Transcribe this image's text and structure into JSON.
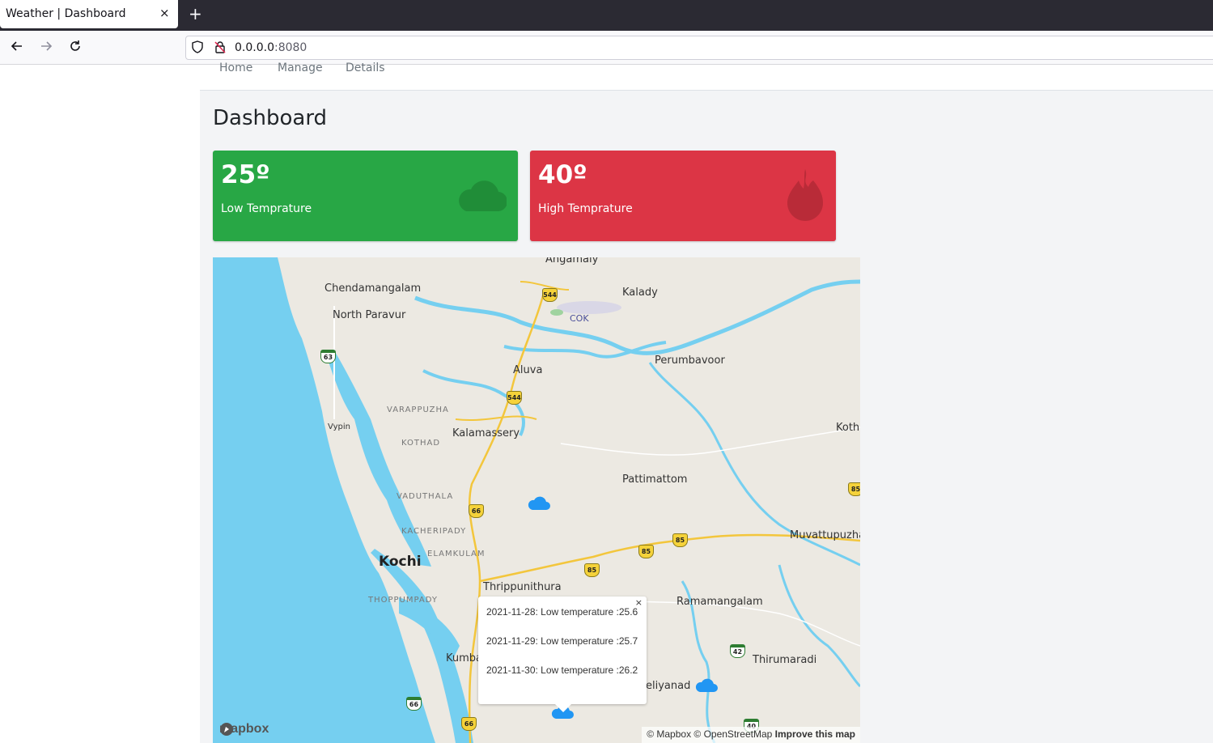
{
  "browser": {
    "tab_title": "Weather | Dashboard",
    "tab_close": "×",
    "new_tab": "+",
    "url_host": "0.0.0.0",
    "url_port": ":8080"
  },
  "nav": {
    "links": [
      "Home",
      "Manage",
      "Details"
    ]
  },
  "page": {
    "title": "Dashboard"
  },
  "cards": [
    {
      "value": "25º",
      "label": "Low Temprature",
      "color": "#28a745",
      "icon": "cloud-icon"
    },
    {
      "value": "40º",
      "label": "High Temprature",
      "color": "#dc3545",
      "icon": "fire-icon"
    }
  ],
  "map": {
    "places": [
      "Angamaly",
      "Chendamangalam",
      "Kalady",
      "North Paravur",
      "COK",
      "Perumbavoor",
      "Aluva",
      "VARAPPUZHA",
      "Vypin",
      "Kalamassery",
      "KOTHAD",
      "Koth",
      "Pattimattom",
      "VADUTHALA",
      "KACHERIPADY",
      "Muvattupuzha",
      "Kochi",
      "ELAMKULAM",
      "Thrippunithura",
      "THOPPUMPADY",
      "Ramamangalam",
      "Kumba",
      "Thirumaradi",
      "eliyanad"
    ],
    "shields": [
      "544",
      "544",
      "63",
      "66",
      "85",
      "85",
      "85",
      "85",
      "42",
      "66",
      "66",
      "40"
    ],
    "popup": {
      "lines": [
        "2021-11-28: Low temperature :25.6",
        "2021-11-29: Low temperature :25.7",
        "2021-11-30: Low temperature :26.2"
      ],
      "close": "×"
    },
    "logo": "mapbox",
    "attribution": "© Mapbox © OpenStreetMap",
    "improve": "Improve this map",
    "marker_color": "#2196f3"
  }
}
